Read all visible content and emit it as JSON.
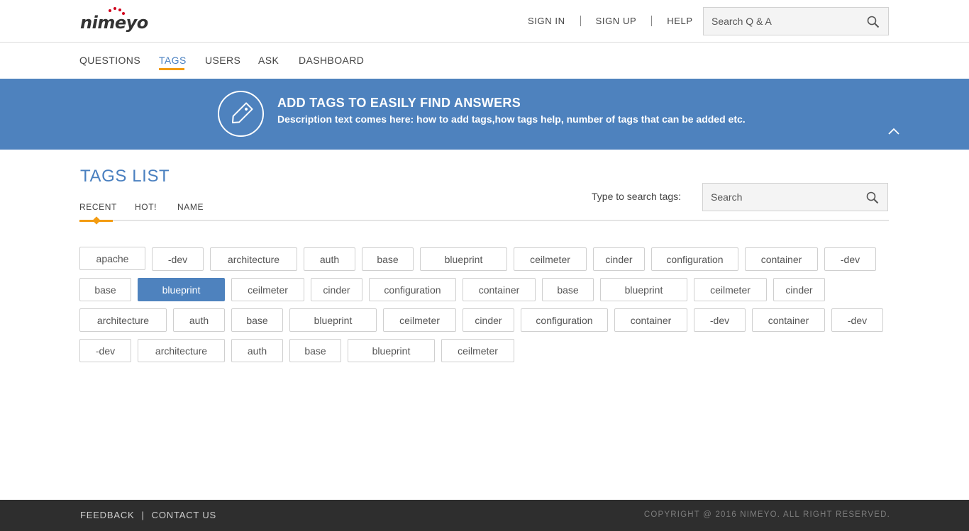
{
  "header": {
    "logo_text": "nimeyo",
    "links": [
      "SIGN IN",
      "SIGN UP",
      "HELP"
    ],
    "search_placeholder": "Search Q & A",
    "brand_color": "#d0021b"
  },
  "nav": {
    "items": [
      "QUESTIONS",
      "TAGS",
      "USERS",
      "ASK",
      "DASHBOARD"
    ],
    "active": "TAGS",
    "accent": "#f39c12"
  },
  "banner": {
    "title": "ADD TAGS TO EASILY FIND ANSWERS",
    "description": "Description text comes here: how to add tags,how tags help, number of tags that can be added etc.",
    "icon": "tag-icon",
    "collapse_icon": "chevron-up-icon",
    "background": "#4e82be"
  },
  "tags_section": {
    "title": "TAGS LIST",
    "tabs": [
      "RECENT",
      "HOT!",
      "NAME"
    ],
    "active_tab": "RECENT",
    "search_label": "Type to search tags:",
    "search_placeholder": "Search",
    "selected_tag": "blueprint",
    "rows": [
      [
        "apache",
        "-dev",
        "architecture",
        "auth",
        "base",
        "blueprint",
        "ceilmeter",
        "cinder",
        "configuration",
        "container",
        "-dev"
      ],
      [
        "base",
        "blueprint",
        "ceilmeter",
        "cinder",
        "configuration",
        "container",
        "base",
        "blueprint",
        "ceilmeter",
        "cinder"
      ],
      [
        "architecture",
        "auth",
        "base",
        "blueprint",
        "ceilmeter",
        "cinder",
        "configuration",
        "container",
        "-dev",
        "container",
        "-dev"
      ],
      [
        "-dev",
        "architecture",
        "auth",
        "base",
        "blueprint",
        "ceilmeter"
      ]
    ]
  },
  "footer": {
    "links": [
      "FEEDBACK",
      "CONTACT US"
    ],
    "separator": "|",
    "copyright": "COPYRIGHT @ 2016 NIMEYO. ALL RIGHT RESERVED."
  }
}
